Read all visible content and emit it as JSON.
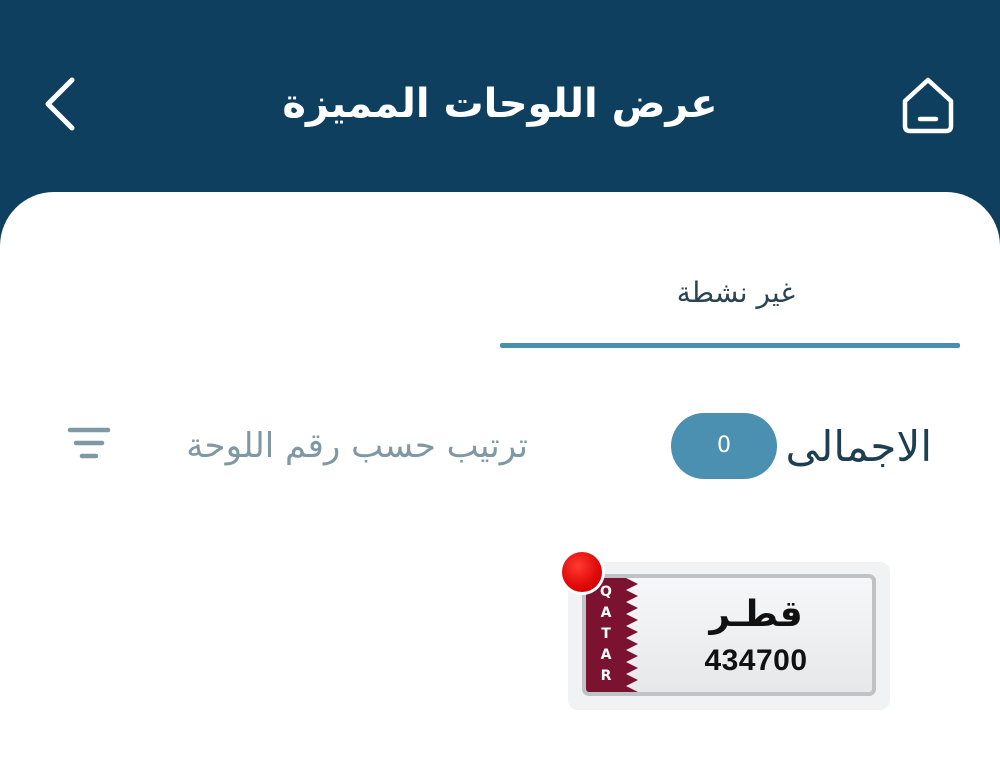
{
  "header": {
    "title": "عرض اللوحات المميزة"
  },
  "tabs": [
    {
      "label": "غير نشطة",
      "active": true
    }
  ],
  "summary": {
    "total_label": "الاجمالى",
    "total_count": "0"
  },
  "sort": {
    "label": "ترتيب حسب رقم اللوحة"
  },
  "plates": [
    {
      "country_ar": "قطـر",
      "country_letters": [
        "Q",
        "A",
        "T",
        "A",
        "R"
      ],
      "number": "434700",
      "status_color": "#e10a0a"
    }
  ],
  "colors": {
    "header_bg": "#0f3f5f",
    "accent": "#4a8fad",
    "badge_bg": "#4b8fb1",
    "flag_maroon": "#7a1230"
  },
  "icons": {
    "back": "chevron-left-icon",
    "home": "home-icon",
    "sort": "sort-lines-icon"
  }
}
